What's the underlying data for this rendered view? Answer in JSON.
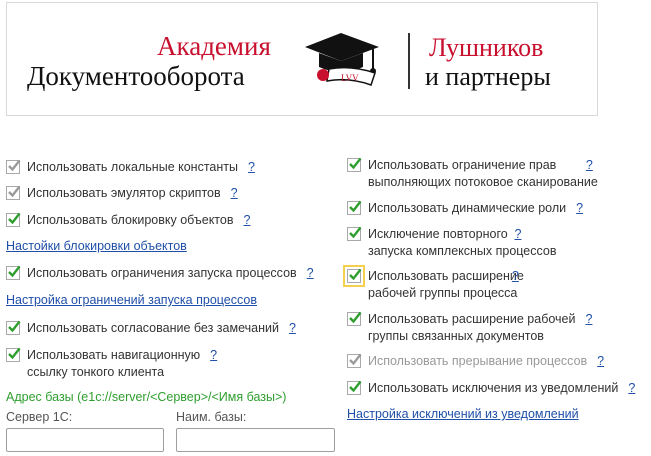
{
  "banner": {
    "academy": "Академия",
    "docflow": "Документооборота",
    "emblem_text": "LVV",
    "partner_line1": "Лушников",
    "partner_line2": "и партнеры"
  },
  "colors": {
    "brand_red": "#c8102e",
    "check_green": "#2e9e2e",
    "link_blue": "#1f4fa8",
    "disabled_gray": "#999999"
  },
  "icons": {
    "check": "checkmark-icon",
    "emblem": "graduation-cap-icon"
  },
  "help_mark": "?",
  "left": {
    "local_constants": {
      "label": "Использовать локальные константы",
      "checked": true,
      "disabled": true
    },
    "script_emulator": {
      "label": "Использовать эмулятор скриптов",
      "checked": true,
      "disabled": true
    },
    "object_locking": {
      "label": "Использовать блокировку объектов",
      "checked": true,
      "disabled": false
    },
    "locking_settings_link": "Настойки блокировки объектов",
    "process_launch_limits": {
      "label": "Использовать ограничения запуска процессов",
      "checked": true,
      "disabled": false
    },
    "launch_limits_link": "Настройка ограничений запуска процессов",
    "approval_no_remarks": {
      "label": "Использовать согласование без замечаний",
      "checked": true,
      "disabled": false
    },
    "nav_link_thin_client": {
      "label_line1": "Использовать навигационную",
      "label_line2": "ссылку тонкого клиента",
      "checked": true,
      "disabled": false
    },
    "base_address": "Адрес базы (e1c://server/<Сервер>/<Имя базы>)",
    "server_label": "Сервер 1С:",
    "server_value": "",
    "base_name_label": "Наим. базы:",
    "base_name_value": ""
  },
  "right": {
    "stream_scan_limit": {
      "label_line1": "Использовать ограничение прав",
      "label_line2": "выполняющих потоковое сканирование",
      "checked": true,
      "disabled": false
    },
    "dynamic_roles": {
      "label": "Использовать динамические роли",
      "checked": true,
      "disabled": false
    },
    "repeat_launch_exclusion": {
      "label_line1": "Исключение повторного",
      "label_line2": "запуска комплексных процессов",
      "checked": true,
      "disabled": false
    },
    "workgroup_extension": {
      "label_line1": "Использовать расширение",
      "label_line2": "рабочей группы процесса",
      "checked": true,
      "disabled": false,
      "focused": true
    },
    "related_docs_workgroup": {
      "label_line1": "Использовать расширение рабочей",
      "label_line2": "группы связанных документов",
      "checked": true,
      "disabled": false
    },
    "process_interruption": {
      "label": "Использовать прерывание процессов",
      "checked": true,
      "disabled": true
    },
    "notification_exclusions": {
      "label": "Использовать исключения из уведомлений",
      "checked": true,
      "disabled": false
    },
    "notification_exclusions_link": "Настройка исключений из уведомлений"
  }
}
